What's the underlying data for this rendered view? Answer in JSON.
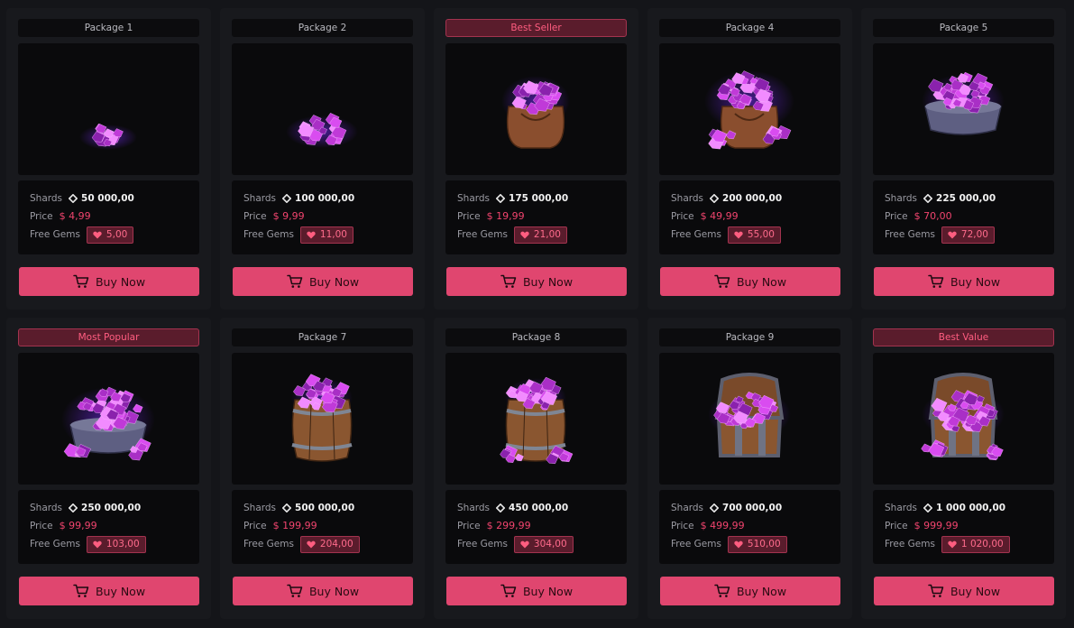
{
  "packages": [
    {
      "tag": "Package 1",
      "highlight": false,
      "art": "small-gem-pile",
      "shards_label": "Shards",
      "shards": "50 000,00",
      "price_label": "Price",
      "price": "$ 4,99",
      "gems_label": "Free Gems",
      "gems": "5,00",
      "buy_label": "Buy Now"
    },
    {
      "tag": "Package 2",
      "highlight": false,
      "art": "gem-pile",
      "shards_label": "Shards",
      "shards": "100 000,00",
      "price_label": "Price",
      "price": "$ 9,99",
      "gems_label": "Free Gems",
      "gems": "11,00",
      "buy_label": "Buy Now"
    },
    {
      "tag": "Best Seller",
      "highlight": true,
      "art": "gem-sack",
      "shards_label": "Shards",
      "shards": "175 000,00",
      "price_label": "Price",
      "price": "$ 19,99",
      "gems_label": "Free Gems",
      "gems": "21,00",
      "buy_label": "Buy Now"
    },
    {
      "tag": "Package 4",
      "highlight": false,
      "art": "large-gem-sack",
      "shards_label": "Shards",
      "shards": "200 000,00",
      "price_label": "Price",
      "price": "$ 49,99",
      "gems_label": "Free Gems",
      "gems": "55,00",
      "buy_label": "Buy Now"
    },
    {
      "tag": "Package 5",
      "highlight": false,
      "art": "gem-bowl",
      "shards_label": "Shards",
      "shards": "225 000,00",
      "price_label": "Price",
      "price": "$ 70,00",
      "gems_label": "Free Gems",
      "gems": "72,00",
      "buy_label": "Buy Now"
    },
    {
      "tag": "Most Popular",
      "highlight": true,
      "art": "large-gem-bowl",
      "shards_label": "Shards",
      "shards": "250 000,00",
      "price_label": "Price",
      "price": "$ 99,99",
      "gems_label": "Free Gems",
      "gems": "103,00",
      "buy_label": "Buy Now"
    },
    {
      "tag": "Package 7",
      "highlight": false,
      "art": "gem-barrel",
      "shards_label": "Shards",
      "shards": "500 000,00",
      "price_label": "Price",
      "price": "$ 199,99",
      "gems_label": "Free Gems",
      "gems": "204,00",
      "buy_label": "Buy Now"
    },
    {
      "tag": "Package 8",
      "highlight": false,
      "art": "large-gem-barrel",
      "shards_label": "Shards",
      "shards": "450 000,00",
      "price_label": "Price",
      "price": "$ 299,99",
      "gems_label": "Free Gems",
      "gems": "304,00",
      "buy_label": "Buy Now"
    },
    {
      "tag": "Package 9",
      "highlight": false,
      "art": "gem-chest",
      "shards_label": "Shards",
      "shards": "700 000,00",
      "price_label": "Price",
      "price": "$ 499,99",
      "gems_label": "Free Gems",
      "gems": "510,00",
      "buy_label": "Buy Now"
    },
    {
      "tag": "Best Value",
      "highlight": true,
      "art": "large-gem-chest",
      "shards_label": "Shards",
      "shards": "1 000 000,00",
      "price_label": "Price",
      "price": "$ 999,99",
      "gems_label": "Free Gems",
      "gems": "1 020,00",
      "buy_label": "Buy Now"
    }
  ],
  "colors": {
    "accent": "#e0466f",
    "price": "#f0446e",
    "badge_bg": "#5a1c2c",
    "gem": "#c03ad8",
    "background": "#141519"
  }
}
